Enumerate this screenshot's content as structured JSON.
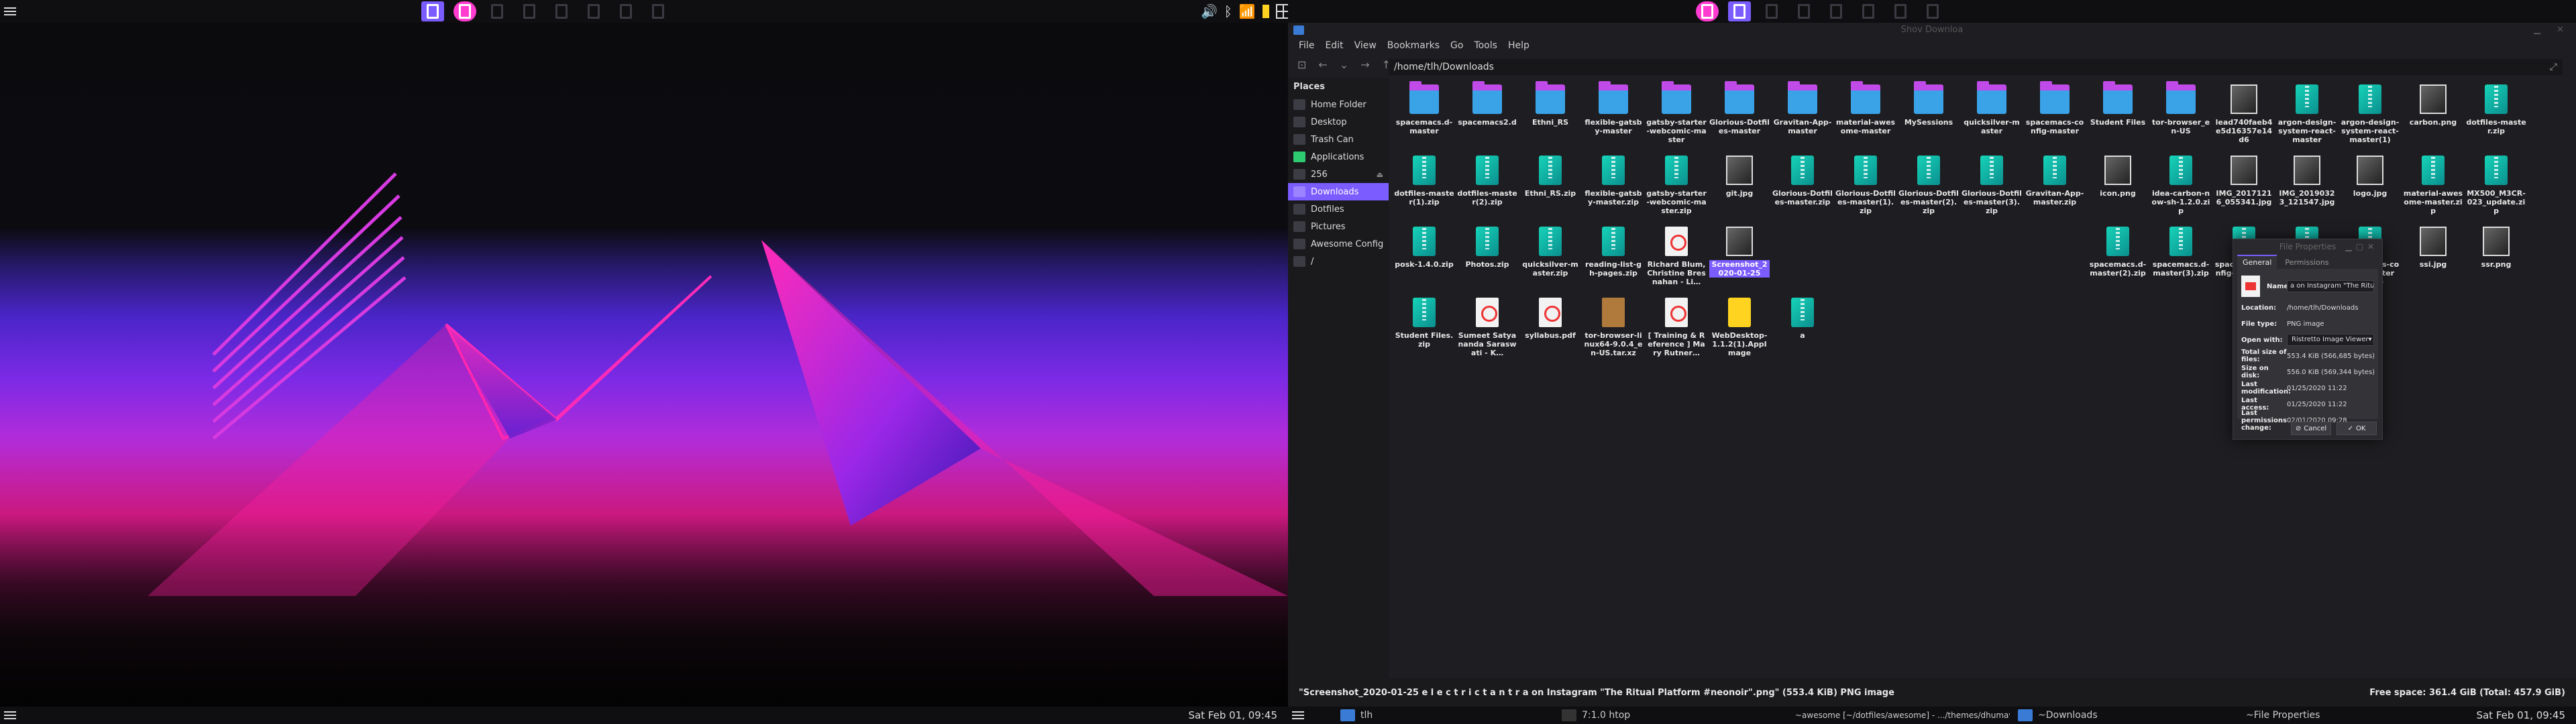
{
  "left_bar": {
    "tags_count": 8,
    "clock": "Sat Feb 01, 09:45"
  },
  "right_bar": {
    "clock": "Sat Feb 01, 09:45",
    "tasks": [
      {
        "label": "tlh"
      },
      {
        "label": "7:1.0 htop"
      },
      {
        "label": "~awesome [~/dotfiles/awesome] - .../themes/dhumavati/layouts.lua - WebSt…"
      },
      {
        "label": "~Downloads"
      },
      {
        "label": "~File Properties"
      }
    ]
  },
  "fm": {
    "title": "Shov Downloa",
    "menu": [
      "File",
      "Edit",
      "View",
      "Bookmarks",
      "Go",
      "Tools",
      "Help"
    ],
    "path": "/home/tlh/Downloads",
    "places_heading": "Places",
    "places": [
      {
        "label": "Home Folder"
      },
      {
        "label": "Desktop"
      },
      {
        "label": "Trash Can"
      },
      {
        "label": "Applications"
      },
      {
        "label": "256"
      },
      {
        "label": "Downloads"
      },
      {
        "label": "Dotfiles"
      },
      {
        "label": "Pictures"
      },
      {
        "label": "Awesome Config"
      },
      {
        "label": "/"
      }
    ],
    "files": [
      [
        "spacemacs.d-master",
        "spacemacs2.d",
        "Ethni_RS",
        "flexible-gatsby-master",
        "gatsby-starter-webcomic-master",
        "Glorious-Dotfiles-master",
        "Gravitan-App-master",
        "material-awesome-master",
        "MySessions",
        "quicksilver-master",
        "spacemacs-config-master",
        "Student Files",
        "tor-browser_en-US",
        "lead740faeb4e5d16357e14d6",
        "argon-design-system-react-master",
        "argon-design-system-react-master(1)",
        "carbon.png",
        "dotfiles-master.zip"
      ],
      [
        "dotfiles-master(1).zip",
        "dotfiles-master(2).zip",
        "Ethni_RS.zip",
        "flexible-gatsby-master.zip",
        "gatsby-starter-webcomic-master.zip",
        "git.jpg",
        "Glorious-Dotfiles-master.zip",
        "Glorious-Dotfiles-master(1).zip",
        "Glorious-Dotfiles-master(2).zip",
        "Glorious-Dotfiles-master(3).zip",
        "Gravitan-App-master.zip",
        "icon.png",
        "idea-carbon-now-sh-1.2.0.zip",
        "IMG_20171216_055341.jpg",
        "IMG_20190323_121547.jpg",
        "logo.jpg",
        "material-awesome-master.zip",
        "MX500_M3CR-023_update.zip"
      ],
      [
        "posk-1.4.0.zip",
        "Photos.zip",
        "quicksilver-master.zip",
        "reading-list-gh-pages.zip",
        "Richard Blum, Christine Bresnahan - Li…",
        "Screenshot_2020-01-25",
        "",
        "",
        "",
        "",
        "",
        "spacemacs.d-master(2).zip",
        "spacemacs.d-master(3).zip",
        "spacemacs-config-master.zip",
        "spacemacs-config-master(1).zip",
        "spacemacs-config-master(2).zip",
        "ssi.jpg",
        "ssr.png"
      ],
      [
        "Student Files.zip",
        "Sumeet Satyananda Saraswati - K…",
        "syllabus.pdf",
        "tor-browser-linux64-9.0.4_en-US.tar.xz",
        "[ Training & Reference ] Mary Rutner…",
        "WebDesktop-1.1.2(1).AppImage",
        "a"
      ]
    ],
    "status": "\"Screenshot_2020-01-25 e l e c t r i c  t a n t r a  on Instagram \"The Ritual Platform #neonoir\".png\" (553.4 KiB) PNG image",
    "free_space": "Free space: 361.4 GiB (Total: 457.9 GiB)"
  },
  "dialog": {
    "title": "File Properties",
    "tabs": [
      "General",
      "Permissions"
    ],
    "name_label": "Name:",
    "name_value": "a on Instagram \"The Ritual Platform #",
    "rows": [
      {
        "k": "Location:",
        "v": "/home/tlh/Downloads"
      },
      {
        "k": "File type:",
        "v": "PNG image"
      },
      {
        "k": "Open with:",
        "v": "Ristretto Image Viewer"
      },
      {
        "k": "Total size of files:",
        "v": "553.4 KiB (566,685 bytes)"
      },
      {
        "k": "Size on disk:",
        "v": "556.0 KiB (569,344 bytes)"
      },
      {
        "k": "Last modification:",
        "v": "01/25/2020 11:22"
      },
      {
        "k": "Last access:",
        "v": "01/25/2020 11:22"
      },
      {
        "k": "Last permissions change:",
        "v": "02/01/2020 09:28"
      }
    ],
    "cancel": "Cancel",
    "ok": "OK"
  },
  "colors": {
    "accent": "#7b5cff",
    "urgent": "#ff3bd0",
    "neon_pink": "#ff1fa0"
  }
}
